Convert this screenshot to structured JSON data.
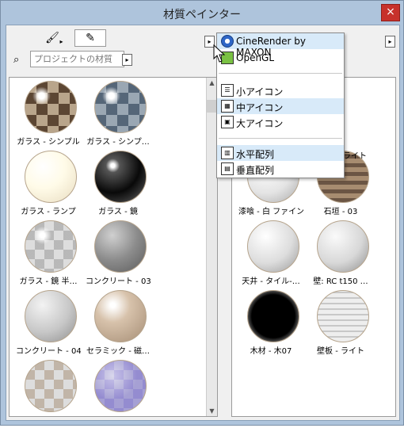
{
  "window": {
    "title": "材質ペインター",
    "close_label": "×"
  },
  "toolbar": {
    "pick_tool_icon": "brush-icon",
    "eyedropper_icon": "eyedropper-icon",
    "left_menu_arrow": "▸",
    "right_menu_arrow": "▸"
  },
  "search": {
    "placeholder": "プロジェクトの材質",
    "arrow": "▸"
  },
  "left_materials": [
    {
      "label": "ガラス - シンプル",
      "style": "glass-check"
    },
    {
      "label": "ガラス - シンプ…",
      "style": "glass-blue"
    },
    {
      "label": "ガラス - ランプ",
      "style": "cream"
    },
    {
      "label": "ガラス - 鏡",
      "style": "mirror"
    },
    {
      "label": "ガラス - 鏡 半…",
      "style": "glass-ghost"
    },
    {
      "label": "コンクリート - 03",
      "style": "concrete"
    },
    {
      "label": "コンクリート - 04",
      "style": "light-concrete"
    },
    {
      "label": "セラミック - 磁…",
      "style": "ceramic"
    },
    {
      "label": "",
      "style": "glass-gray"
    },
    {
      "label": "",
      "style": "purple-glass"
    }
  ],
  "right_materials": [
    {
      "label": "漆喰 - 白 ファイン",
      "style": "plaster"
    },
    {
      "label": "石垣 - 03",
      "style": "stone"
    },
    {
      "label": "天井 - タイル-…",
      "style": "tile"
    },
    {
      "label": "壁: RC t150 …",
      "style": "wall"
    },
    {
      "label": "木材 - 木07",
      "style": "black-wood"
    },
    {
      "label": "壁板 - ライト",
      "style": "stripe"
    }
  ],
  "right_top_labels": [
    "ライト"
  ],
  "menu": {
    "renderers": [
      {
        "label": "CineRender by MAXON",
        "icon": "cinerender-icon",
        "selected": true
      },
      {
        "label": "OpenGL",
        "icon": "opengl-icon",
        "selected": false
      }
    ],
    "icon_sizes": [
      {
        "label": "小アイコン",
        "icon": "small-icons-icon",
        "selected": false
      },
      {
        "label": "中アイコン",
        "icon": "medium-icons-icon",
        "selected": true
      },
      {
        "label": "大アイコン",
        "icon": "large-icons-icon",
        "selected": false
      }
    ],
    "layouts": [
      {
        "label": "水平配列",
        "icon": "horizontal-layout-icon",
        "selected": true
      },
      {
        "label": "垂直配列",
        "icon": "vertical-layout-icon",
        "selected": false
      }
    ]
  },
  "colors": {
    "window_border": "#7a8fa6",
    "title_bar": "#aec4dc",
    "close_red": "#c7312b",
    "menu_selection": "#d8eaf9"
  }
}
